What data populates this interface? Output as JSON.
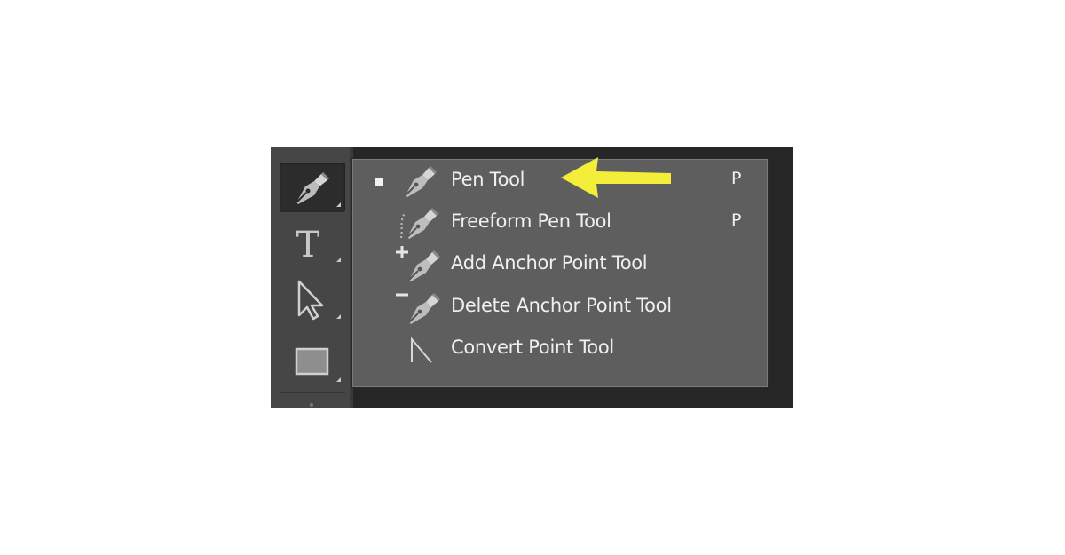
{
  "toolbar": {
    "tools": [
      {
        "name": "Pen",
        "icon": "pen-icon",
        "active": true
      },
      {
        "name": "Type",
        "icon": "type-icon",
        "glyph": "T",
        "active": false
      },
      {
        "name": "Path Selection",
        "icon": "arrow-cursor-icon",
        "active": false
      },
      {
        "name": "Rectangle",
        "icon": "rectangle-icon",
        "active": false
      }
    ]
  },
  "flyout": {
    "items": [
      {
        "label": "Pen Tool",
        "shortcut": "P",
        "selected": true,
        "icon": "pen-icon"
      },
      {
        "label": "Freeform Pen Tool",
        "shortcut": "P",
        "selected": false,
        "icon": "freeform-pen-icon"
      },
      {
        "label": "Add Anchor Point Tool",
        "shortcut": "",
        "selected": false,
        "icon": "add-anchor-point-icon"
      },
      {
        "label": "Delete Anchor Point Tool",
        "shortcut": "",
        "selected": false,
        "icon": "delete-anchor-point-icon"
      },
      {
        "label": "Convert Point Tool",
        "shortcut": "",
        "selected": false,
        "icon": "convert-point-icon"
      }
    ]
  },
  "annotation": {
    "icon": "arrow-left-icon",
    "color": "#f2ee3a"
  },
  "colors": {
    "toolbar_bg": "#464646",
    "flyout_bg": "#5e5e5e",
    "backdrop": "#262626",
    "text": "#f0f0f0"
  }
}
